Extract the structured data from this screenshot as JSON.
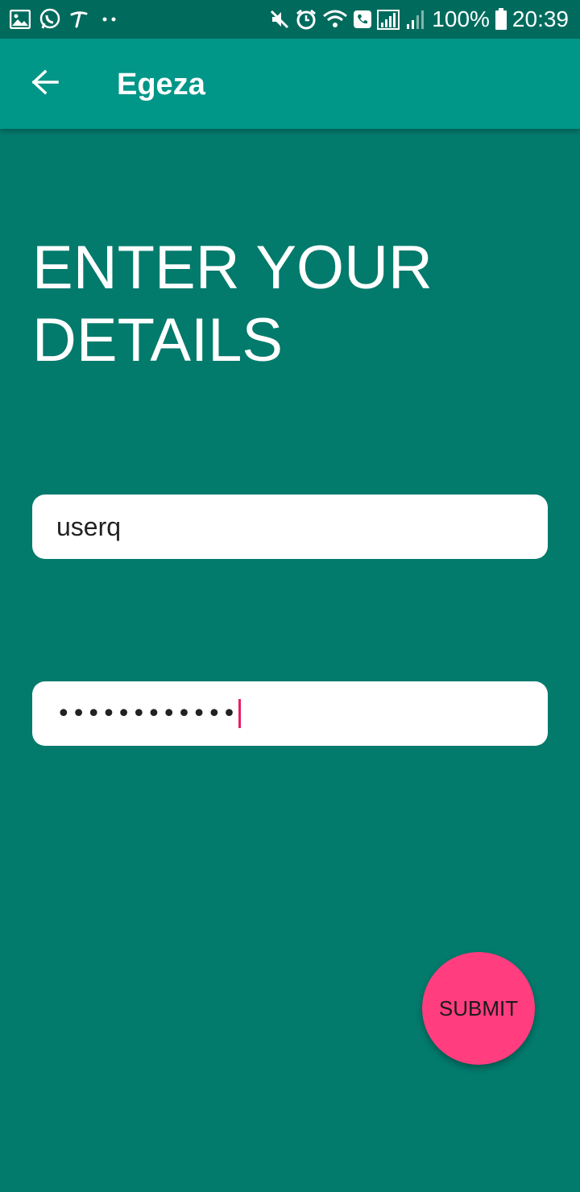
{
  "status_bar": {
    "battery_percent": "100%",
    "time": "20:39",
    "left_icons": [
      "gallery-icon",
      "whatsapp-icon",
      "t-icon",
      "more-dots-icon"
    ],
    "right_icons": [
      "mute-icon",
      "alarm-icon",
      "wifi-icon",
      "call-icon",
      "signal-icon",
      "signal-icon-2",
      "battery-icon"
    ]
  },
  "app_bar": {
    "title": "Egeza",
    "back_icon": "arrow-left-icon",
    "background": "#009688"
  },
  "main": {
    "heading": "ENTER YOUR DETAILS",
    "username_value": "userq",
    "password_masked": "••••••••••••",
    "background": "#027A6C"
  },
  "submit": {
    "label": "SUBMIT",
    "color": "#FF3D7F"
  }
}
